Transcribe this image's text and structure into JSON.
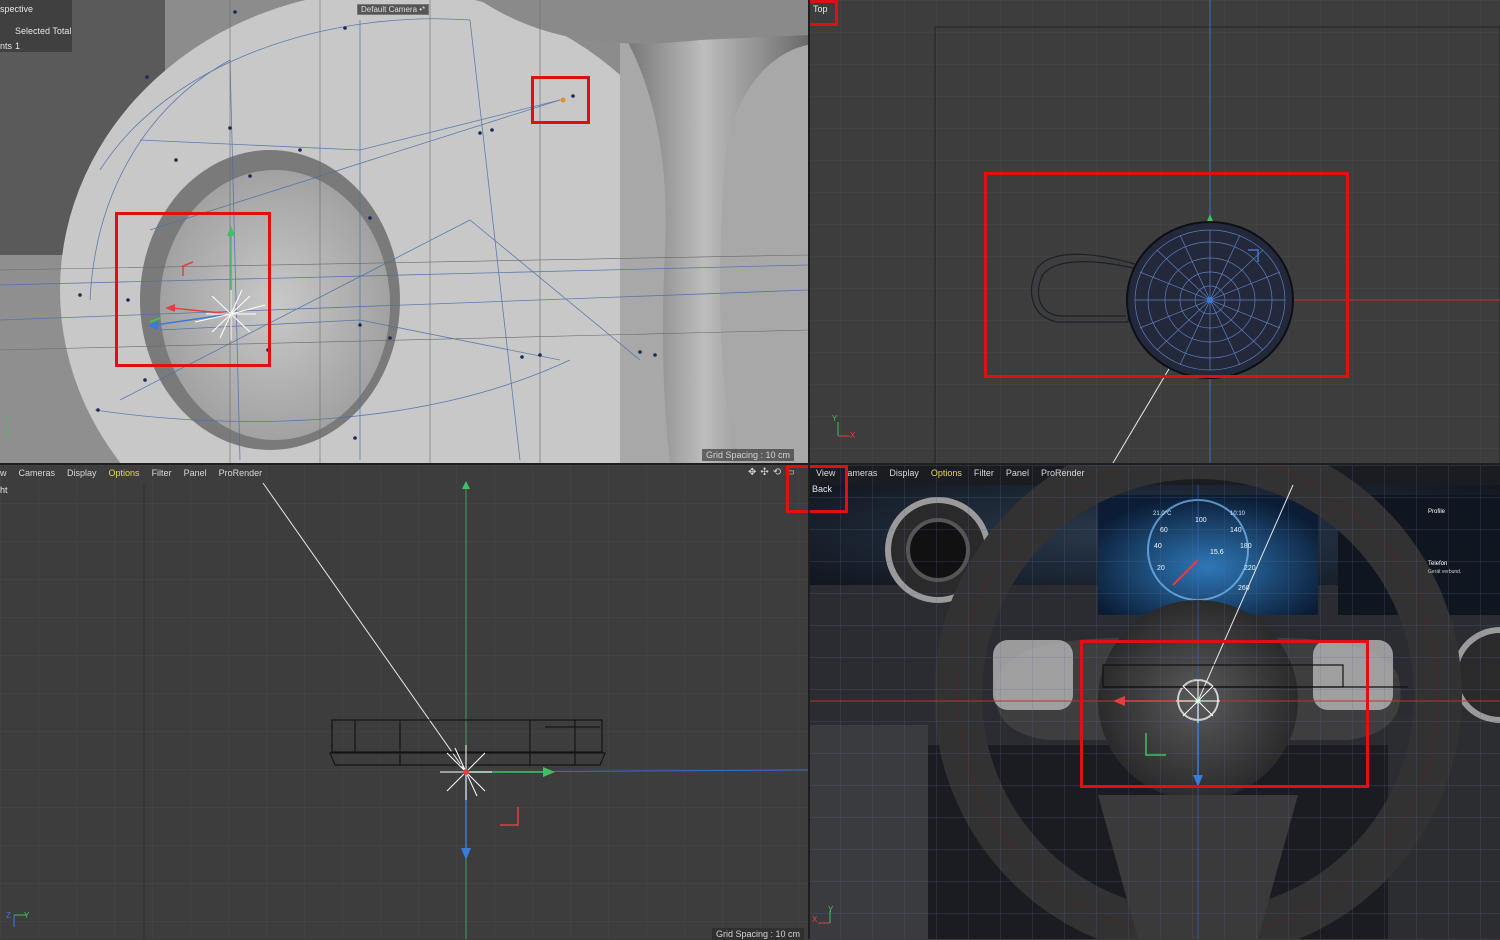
{
  "viewports": {
    "perspective": {
      "name": "Perspective",
      "name_visible": "spective",
      "camera": "Default Camera",
      "camera_icon": "•*",
      "info_header": "Selected Total",
      "info_row_label": "nts",
      "info_row_value": "1",
      "grid_spacing": "Grid Spacing : 10 cm",
      "axis_y": "Y"
    },
    "top": {
      "name": "Top",
      "axis_y": "Y",
      "axis_x": "X"
    },
    "right": {
      "name_visible": "ht",
      "menu": [
        "w",
        "Cameras",
        "Display",
        "Options",
        "Filter",
        "Panel",
        "ProRender"
      ],
      "highlighted_menu": "Options",
      "grid_spacing": "",
      "axis_z": "Z",
      "axis_y": "Y"
    },
    "back": {
      "name": "Back",
      "menu": [
        "View",
        "ameras",
        "Display",
        "Options",
        "Filter",
        "Panel",
        "ProRender"
      ],
      "highlighted_menu": "Options",
      "grid_spacing": "Grid Spacing : 10 cm",
      "axis_x": "X",
      "axis_y": "Y"
    }
  },
  "dashboard": {
    "temp": "21.0°C",
    "time": "10:10",
    "speed_ticks": [
      "40",
      "60",
      "100",
      "140",
      "180",
      "20",
      "220",
      "260"
    ],
    "odometer": "15.6",
    "phone_label": "Telefon",
    "phone_sub": "Gerät verbund.",
    "profile": "Profile"
  },
  "colors": {
    "highlight_red": "#e01010",
    "menu_highlight": "#e8d84a",
    "axis_x": "#e04040",
    "axis_y": "#40c060",
    "axis_z": "#3a7ad8"
  }
}
